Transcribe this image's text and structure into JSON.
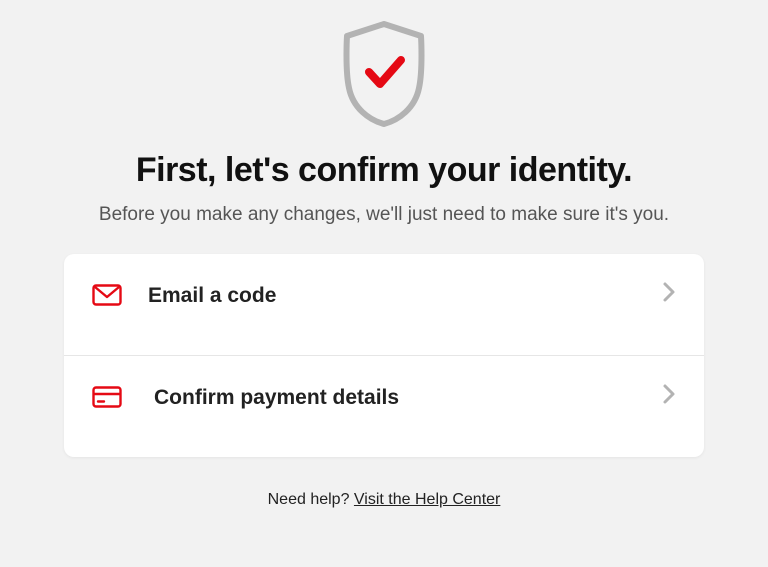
{
  "header": {
    "title": "First, let's confirm your identity.",
    "subtitle": "Before you make any changes, we'll just need to make sure it's you."
  },
  "options": [
    {
      "icon": "envelope",
      "label": "Email a code"
    },
    {
      "icon": "card",
      "label": "Confirm payment details"
    }
  ],
  "footer": {
    "prompt": "Need help? ",
    "link_text": "Visit the Help Center"
  },
  "colors": {
    "accent": "#e50914",
    "shield_stroke": "#b3b3b3",
    "chevron": "#b3b3b3"
  }
}
